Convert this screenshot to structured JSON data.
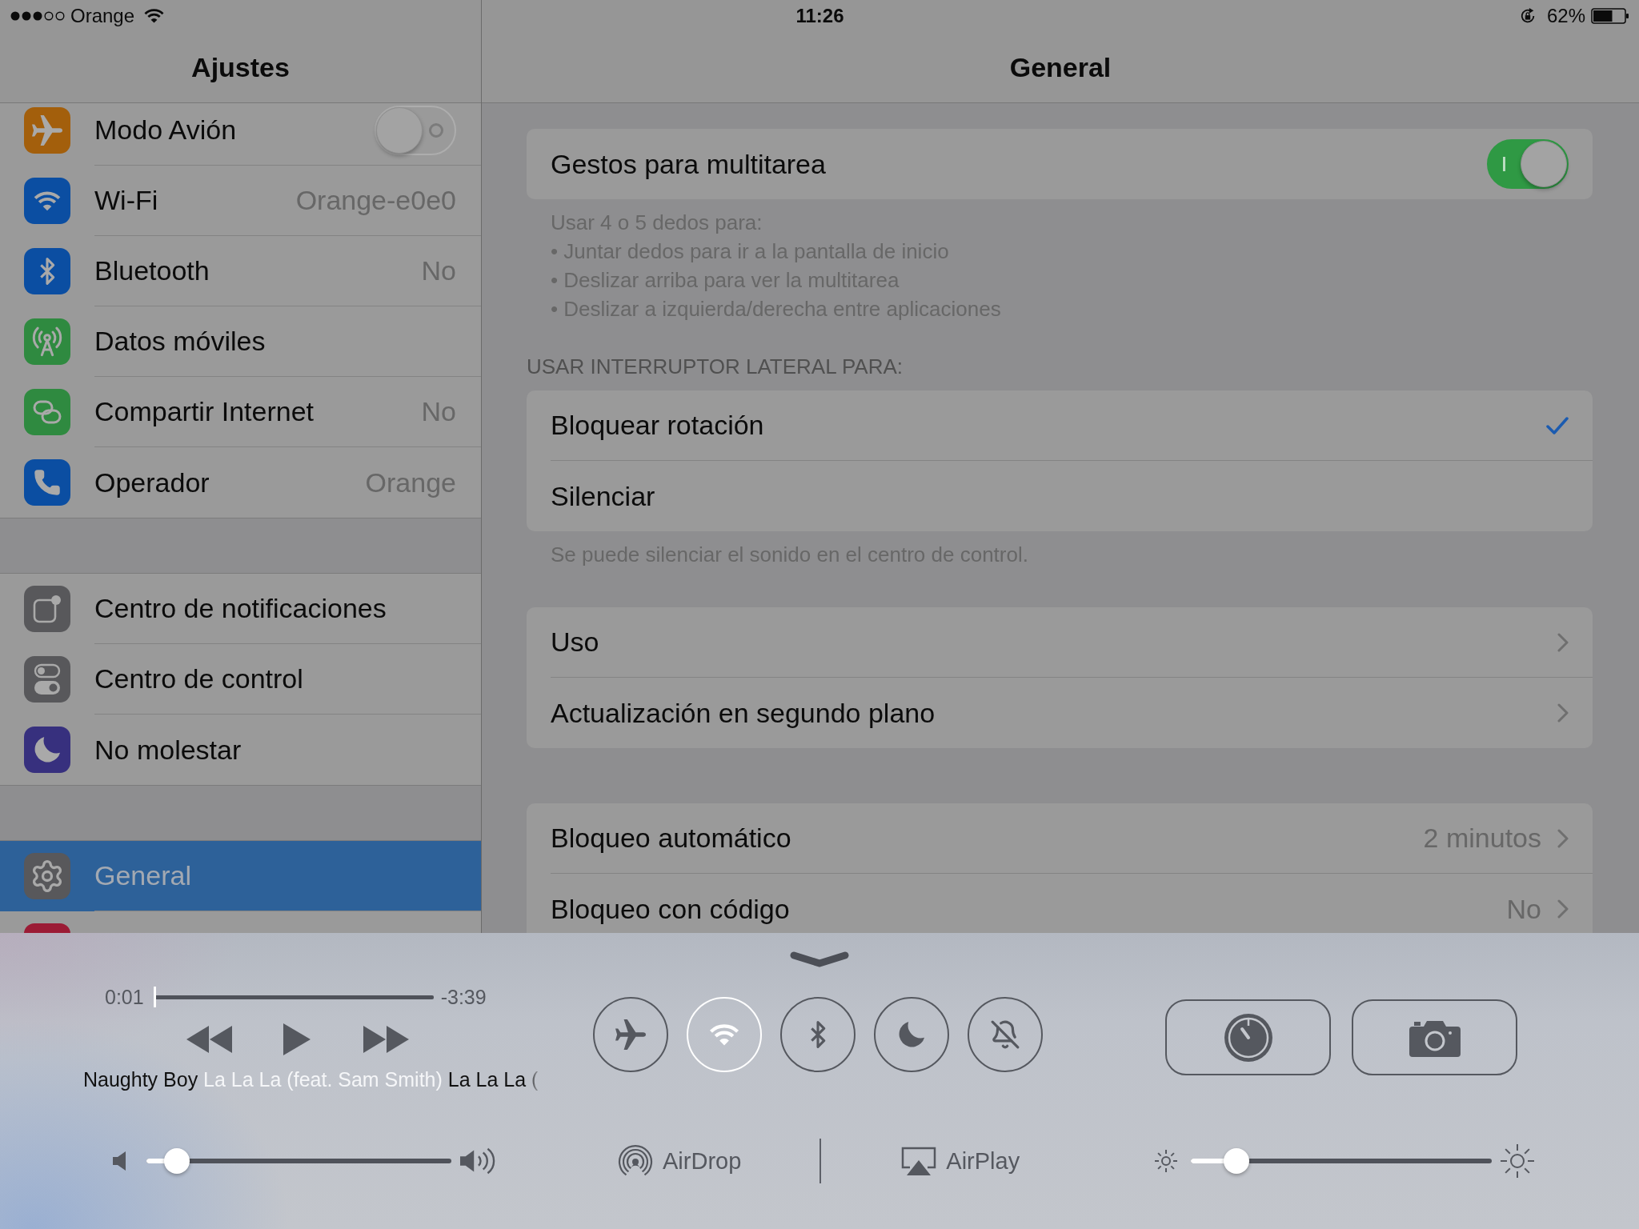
{
  "status_bar": {
    "carrier": "Orange",
    "time": "11:26",
    "battery_percent": "62%"
  },
  "sidebar": {
    "title": "Ajustes",
    "groups": [
      {
        "items": [
          {
            "label": "Modo Avión",
            "kind": "switch",
            "on": false,
            "color": "#a35f0c",
            "selected": false
          },
          {
            "label": "Wi-Fi",
            "kind": "link",
            "value": "Orange-e0e0",
            "color": "#0b4ea2",
            "selected": false
          },
          {
            "label": "Bluetooth",
            "kind": "link",
            "value": "No",
            "color": "#0b4ea2",
            "selected": false
          },
          {
            "label": "Datos móviles",
            "kind": "link",
            "color": "#2f8a40",
            "selected": false
          },
          {
            "label": "Compartir Internet",
            "kind": "link",
            "value": "No",
            "color": "#2f8a40",
            "selected": false
          },
          {
            "label": "Operador",
            "kind": "link",
            "value": "Orange",
            "color": "#0b4ea2",
            "selected": false
          }
        ]
      },
      {
        "items": [
          {
            "label": "Centro de notificaciones",
            "kind": "link",
            "color": "#58585b",
            "selected": false
          },
          {
            "label": "Centro de control",
            "kind": "link",
            "color": "#58585b",
            "selected": false
          },
          {
            "label": "No molestar",
            "kind": "link",
            "color": "#37307e",
            "selected": false
          }
        ]
      },
      {
        "items": [
          {
            "label": "General",
            "kind": "link",
            "color": "#58585b",
            "selected": true
          },
          {
            "kind": "link",
            "color": "#9b1b35",
            "selected": false
          }
        ]
      }
    ]
  },
  "detail": {
    "title": "General",
    "sections": [
      {
        "rows": [
          {
            "label": "Gestos para multitarea",
            "kind": "switch",
            "on": true
          }
        ],
        "footer": [
          "Usar 4 o 5 dedos para:",
          "• Juntar dedos para ir a la pantalla de inicio",
          "• Deslizar arriba para ver la multitarea",
          "• Deslizar a izquierda/derecha entre aplicaciones"
        ]
      },
      {
        "header": "USAR INTERRUPTOR LATERAL PARA:",
        "rows": [
          {
            "label": "Bloquear rotación",
            "kind": "check",
            "selected": true
          },
          {
            "label": "Silenciar",
            "kind": "check",
            "selected": false
          }
        ],
        "footer": [
          "Se puede silenciar el sonido en el centro de control."
        ]
      },
      {
        "rows": [
          {
            "label": "Uso",
            "kind": "link"
          },
          {
            "label": "Actualización en segundo plano",
            "kind": "link"
          }
        ]
      },
      {
        "rows": [
          {
            "label": "Bloqueo automático",
            "kind": "link",
            "value": "2 minutos"
          },
          {
            "label": "Bloqueo con código",
            "kind": "link",
            "value": "No"
          }
        ]
      }
    ]
  },
  "control_center": {
    "progress": {
      "elapsed": "0:01",
      "remaining": "-3:39",
      "level": 0.005
    },
    "now_playing": {
      "artist": "Naughty Boy",
      "title": "La La La (feat. Sam Smith)",
      "album": "La La La ("
    },
    "toggles": [
      {
        "on": false
      },
      {
        "on": true
      },
      {
        "on": false
      },
      {
        "on": false
      },
      {
        "on": false
      }
    ],
    "volume": {
      "level": 0.1
    },
    "airdrop": "AirDrop",
    "airplay": "AirPlay",
    "brightness": {
      "level": 0.15
    }
  }
}
